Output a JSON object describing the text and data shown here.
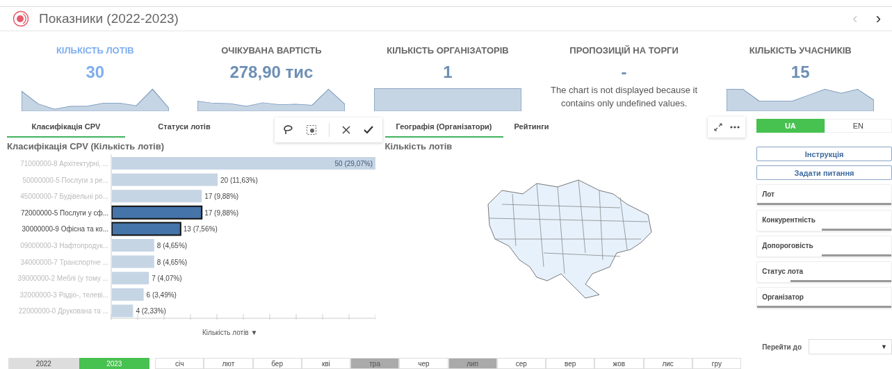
{
  "header": {
    "title": "Показники (2022-2023)",
    "prev": "‹",
    "next": "›"
  },
  "kpis": [
    {
      "title": "КІЛЬКІСТЬ ЛОТІВ",
      "value": "30",
      "selected": true,
      "kind": "sparkline"
    },
    {
      "title": "ОЧІКУВАНА ВАРТІСТЬ",
      "value": "278,90 тис",
      "selected": false,
      "kind": "sparkline"
    },
    {
      "title": "КІЛЬКІСТЬ ОРГАНІЗАТОРІВ",
      "value": "1",
      "selected": false,
      "kind": "flat"
    },
    {
      "title": "ПРОПОЗИЦІЙ НА ТОРГИ",
      "value": "-",
      "selected": false,
      "kind": "message",
      "message": "The chart is not displayed because it contains only undefined values."
    },
    {
      "title": "КІЛЬКІСТЬ УЧАСНИКІВ",
      "value": "15",
      "selected": false,
      "kind": "sparkline"
    }
  ],
  "left_tabs": [
    {
      "label": "Класифікація CPV",
      "selected": true
    },
    {
      "label": "Статуси лотів",
      "selected": false
    }
  ],
  "cpv_chart": {
    "title": "Класифікація CPV (Кількість лотів)",
    "axis_caret": "▼",
    "chart_data": {
      "type": "bar",
      "orientation": "horizontal",
      "xlabel": "Кількість лотів",
      "categories": [
        "71000000-8 Архітектурні, ...",
        "50000000-5 Послуги з ре...",
        "45000000-7 Будівельні ро...",
        "72000000-5 Послуги у сф...",
        "30000000-9 Офісна та ко...",
        "09000000-3 Нафтопродук...",
        "34000000-7 Транспортне ...",
        "39000000-2 Меблі (у тому ...",
        "32000000-3 Радіо-, телеві...",
        "22000000-0 Друкована та ..."
      ],
      "values": [
        50,
        20,
        17,
        17,
        13,
        8,
        8,
        7,
        6,
        4
      ],
      "value_labels": [
        "50 (29,07%)",
        "20 (11,63%)",
        "17 (9,88%)",
        "17 (9,88%)",
        "13 (7,56%)",
        "8 (4,65%)",
        "8 (4,65%)",
        "7 (4,07%)",
        "6 (3,49%)",
        "4 (2,33%)"
      ]
    },
    "bar_selection": [
      false,
      false,
      false,
      true,
      true,
      false,
      false,
      false,
      false,
      false
    ]
  },
  "mid_tabs": [
    {
      "label": "Географія (Організатори)",
      "selected": true
    },
    {
      "label": "Рейтинги",
      "selected": false
    }
  ],
  "map": {
    "title": "Кількість лотів"
  },
  "languages": [
    {
      "label": "UA",
      "selected": true
    },
    {
      "label": "EN",
      "selected": false
    }
  ],
  "buttons": [
    "Інструкція",
    "Задати питання"
  ],
  "filters": [
    {
      "label": "Лот",
      "level": 1
    },
    {
      "label": "Конкурентність",
      "level": 0.52
    },
    {
      "label": "Допороговість",
      "level": 0.52
    },
    {
      "label": "Статус лота",
      "level": 0.75
    },
    {
      "label": "Організатор",
      "level": 1
    }
  ],
  "goto": {
    "label": "Перейти до",
    "caret": "▼"
  },
  "years": [
    {
      "label": "2022",
      "selected": false
    },
    {
      "label": "2023",
      "selected": true
    }
  ],
  "months": [
    {
      "label": "січ",
      "disabled": false
    },
    {
      "label": "лют",
      "disabled": false
    },
    {
      "label": "бер",
      "disabled": false
    },
    {
      "label": "кві",
      "disabled": false
    },
    {
      "label": "тра",
      "disabled": true
    },
    {
      "label": "чер",
      "disabled": false
    },
    {
      "label": "лип",
      "disabled": true
    },
    {
      "label": "сер",
      "disabled": false
    },
    {
      "label": "вер",
      "disabled": false
    },
    {
      "label": "жов",
      "disabled": false
    },
    {
      "label": "лис",
      "disabled": false
    },
    {
      "label": "гру",
      "disabled": false
    }
  ]
}
